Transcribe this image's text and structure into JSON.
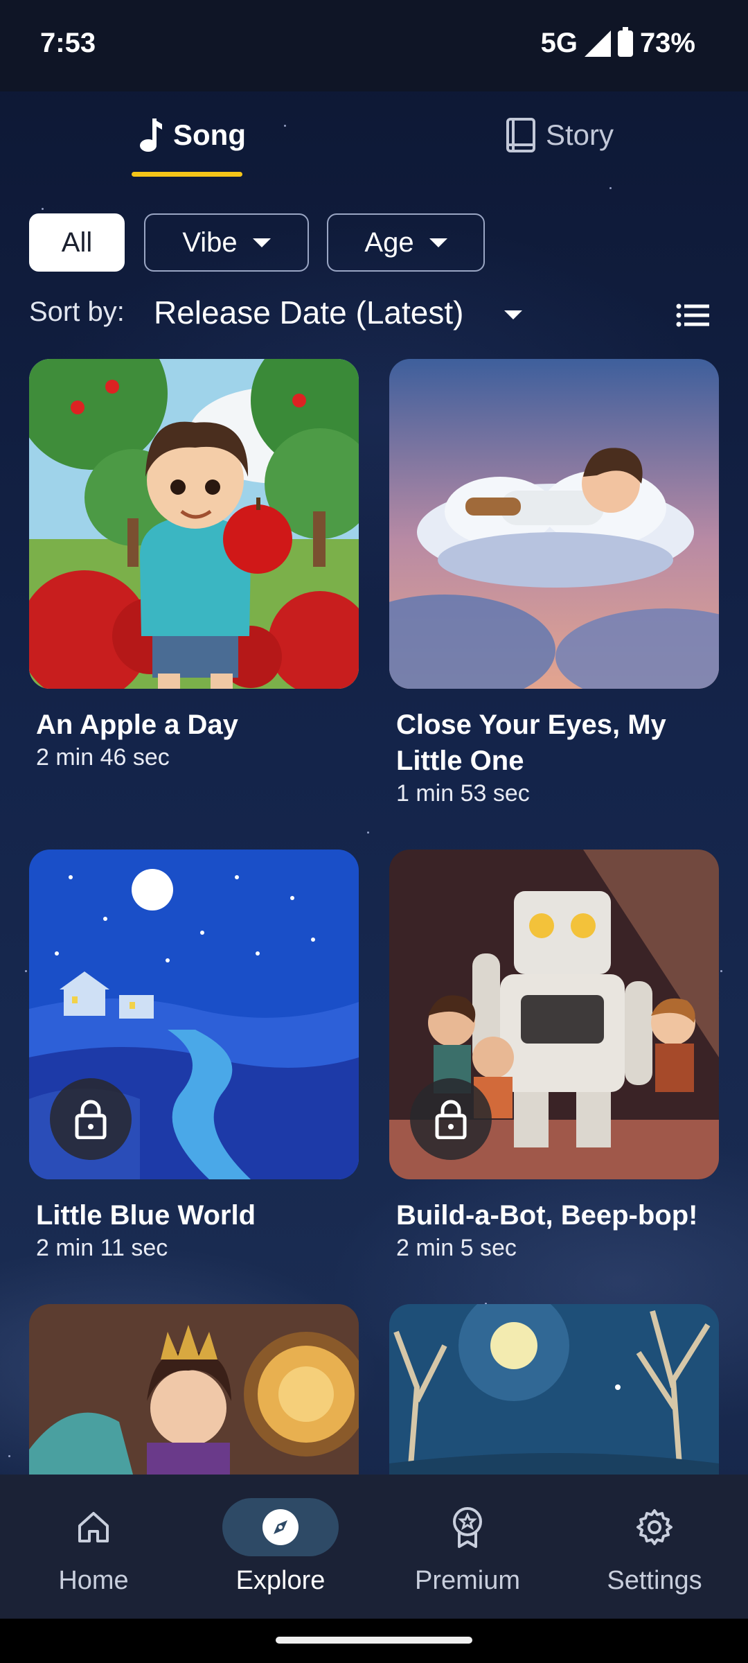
{
  "status_bar": {
    "time": "7:53",
    "network": "5G",
    "battery": "73%"
  },
  "tabs": [
    {
      "label": "Song",
      "icon": "music-note-icon",
      "selected": true
    },
    {
      "label": "Story",
      "icon": "book-icon",
      "selected": false
    }
  ],
  "filters": {
    "all": "All",
    "vibe": "Vibe",
    "age": "Age"
  },
  "sort": {
    "label": "Sort by:",
    "value": "Release Date (Latest)"
  },
  "items": [
    {
      "title": "An Apple a Day",
      "duration": "2 min 46 sec",
      "locked": false
    },
    {
      "title": "Close Your Eyes, My Little One",
      "duration": "1 min 53 sec",
      "locked": false
    },
    {
      "title": "Little Blue World",
      "duration": "2 min 11 sec",
      "locked": true
    },
    {
      "title": "Build-a-Bot, Beep-bop!",
      "duration": "2 min 5 sec",
      "locked": true
    }
  ],
  "nav": [
    {
      "label": "Home",
      "icon": "home-icon"
    },
    {
      "label": "Explore",
      "icon": "compass-icon",
      "selected": true
    },
    {
      "label": "Premium",
      "icon": "award-icon"
    },
    {
      "label": "Settings",
      "icon": "gear-icon"
    }
  ],
  "colors": {
    "tab_indicator": "#f5c518",
    "nav_selected": "#2e4a66",
    "nav_bg": "#1b2236"
  }
}
